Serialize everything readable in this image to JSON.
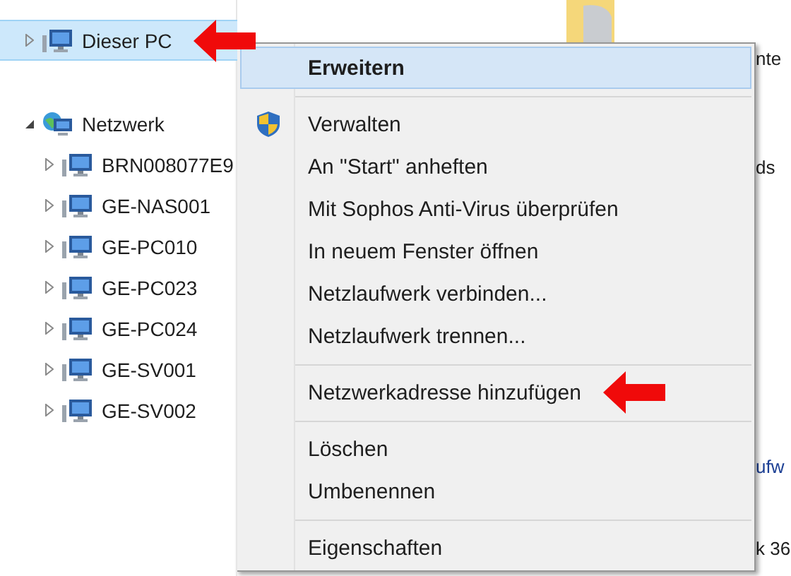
{
  "tree": [
    {
      "label": "Dieser PC",
      "kind": "computer",
      "expanded": false,
      "selected": true,
      "marked": true
    },
    {
      "label": "Netzwerk",
      "kind": "network",
      "expanded": true,
      "selected": false,
      "marked": false,
      "children": [
        {
          "label": "BRN008077E9",
          "kind": "computer",
          "expanded": false,
          "selected": false,
          "marked": false
        },
        {
          "label": "GE-NAS001",
          "kind": "computer",
          "expanded": false,
          "selected": false,
          "marked": false
        },
        {
          "label": "GE-PC010",
          "kind": "computer",
          "expanded": false,
          "selected": false,
          "marked": false
        },
        {
          "label": "GE-PC023",
          "kind": "computer",
          "expanded": false,
          "selected": false,
          "marked": false
        },
        {
          "label": "GE-PC024",
          "kind": "computer",
          "expanded": false,
          "selected": false,
          "marked": false
        },
        {
          "label": "GE-SV001",
          "kind": "computer",
          "expanded": false,
          "selected": false,
          "marked": false
        },
        {
          "label": "GE-SV002",
          "kind": "computer",
          "expanded": false,
          "selected": false,
          "marked": false
        }
      ]
    }
  ],
  "content": {
    "fragments": [
      {
        "text": "nte",
        "kind": "plain"
      },
      {
        "text": "ds",
        "kind": "plain"
      },
      {
        "text": "ufw",
        "kind": "link"
      },
      {
        "text": "k 36",
        "kind": "plain"
      }
    ]
  },
  "context_menu": {
    "items": [
      {
        "kind": "item",
        "label": "Erweitern",
        "default": true,
        "selected": true,
        "marked": false
      },
      {
        "kind": "separator"
      },
      {
        "kind": "shield-item",
        "label": "Verwalten",
        "default": false,
        "selected": false,
        "marked": false
      },
      {
        "kind": "item",
        "label": "An \"Start\" anheften",
        "default": false,
        "selected": false,
        "marked": false
      },
      {
        "kind": "item",
        "label": "Mit Sophos Anti-Virus überprüfen",
        "default": false,
        "selected": false,
        "marked": false
      },
      {
        "kind": "item",
        "label": "In neuem Fenster öffnen",
        "default": false,
        "selected": false,
        "marked": false
      },
      {
        "kind": "item",
        "label": "Netzlaufwerk verbinden...",
        "default": false,
        "selected": false,
        "marked": false
      },
      {
        "kind": "item",
        "label": "Netzlaufwerk trennen...",
        "default": false,
        "selected": false,
        "marked": false
      },
      {
        "kind": "separator"
      },
      {
        "kind": "item",
        "label": "Netzwerkadresse hinzufügen",
        "default": false,
        "selected": false,
        "marked": true
      },
      {
        "kind": "separator"
      },
      {
        "kind": "item",
        "label": "Löschen",
        "default": false,
        "selected": false,
        "marked": false
      },
      {
        "kind": "item",
        "label": "Umbenennen",
        "default": false,
        "selected": false,
        "marked": false
      },
      {
        "kind": "separator"
      },
      {
        "kind": "item",
        "label": "Eigenschaften",
        "default": false,
        "selected": false,
        "marked": false
      }
    ]
  }
}
